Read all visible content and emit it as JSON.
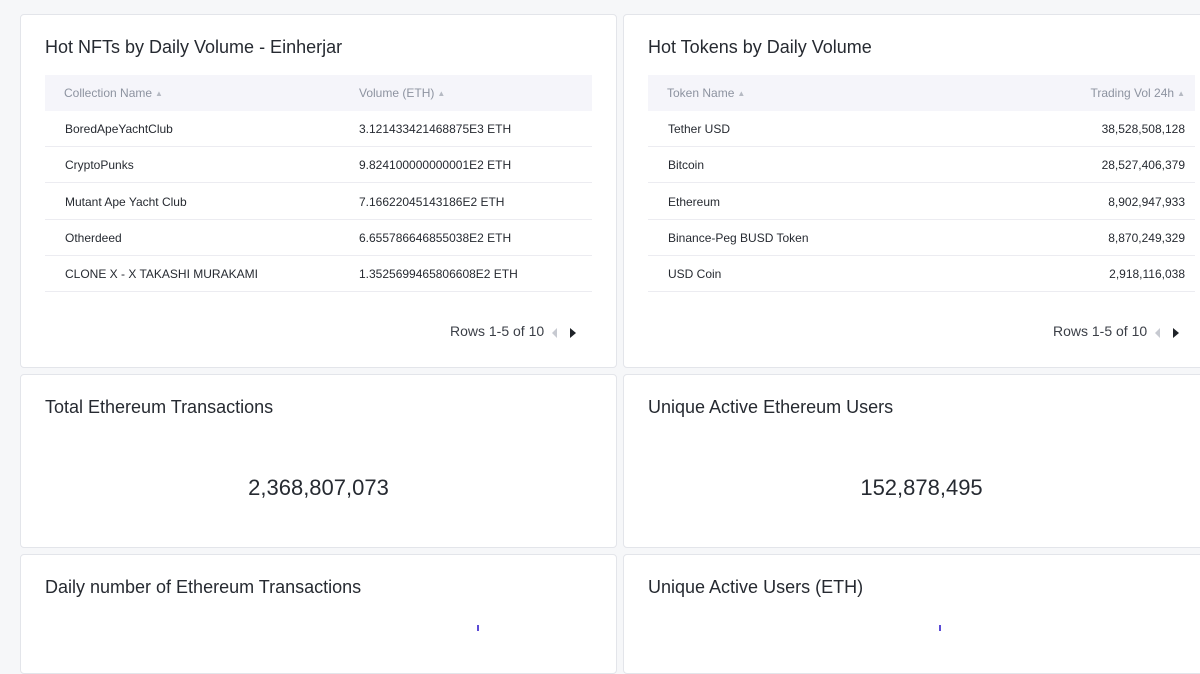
{
  "nft_card": {
    "title": "Hot NFTs by Daily Volume - Einherjar",
    "columns": [
      "Collection Name",
      "Volume (ETH)"
    ],
    "rows": [
      [
        "BoredApeYachtClub",
        "3.121433421468875E3 ETH"
      ],
      [
        "CryptoPunks",
        "9.824100000000001E2 ETH"
      ],
      [
        "Mutant Ape Yacht Club",
        "7.16622045143186E2 ETH"
      ],
      [
        "Otherdeed",
        "6.655786646855038E2 ETH"
      ],
      [
        "CLONE X - X TAKASHI MURAKAMI",
        "1.3525699465806608E2 ETH"
      ]
    ],
    "pager": "Rows 1-5 of 10"
  },
  "token_card": {
    "title": "Hot Tokens by Daily Volume",
    "columns": [
      "Token Name",
      "Trading Vol 24h"
    ],
    "rows": [
      [
        "Tether USD",
        "38,528,508,128"
      ],
      [
        "Bitcoin",
        "28,527,406,379"
      ],
      [
        "Ethereum",
        "8,902,947,933"
      ],
      [
        "Binance-Peg BUSD Token",
        "8,870,249,329"
      ],
      [
        "USD Coin",
        "2,918,116,038"
      ]
    ],
    "pager": "Rows 1-5 of 10"
  },
  "tx_card": {
    "title": "Total Ethereum Transactions",
    "value": "2,368,807,073"
  },
  "users_card": {
    "title": "Unique Active Ethereum Users",
    "value": "152,878,495"
  },
  "daily_tx_card": {
    "title": "Daily number of Ethereum Transactions"
  },
  "active_users_card": {
    "title": "Unique Active Users (ETH)"
  },
  "colors": {
    "accent": "#5b4bd6",
    "background": "#f6f7f9",
    "card": "#ffffff",
    "header_row": "#f5f5fa"
  }
}
